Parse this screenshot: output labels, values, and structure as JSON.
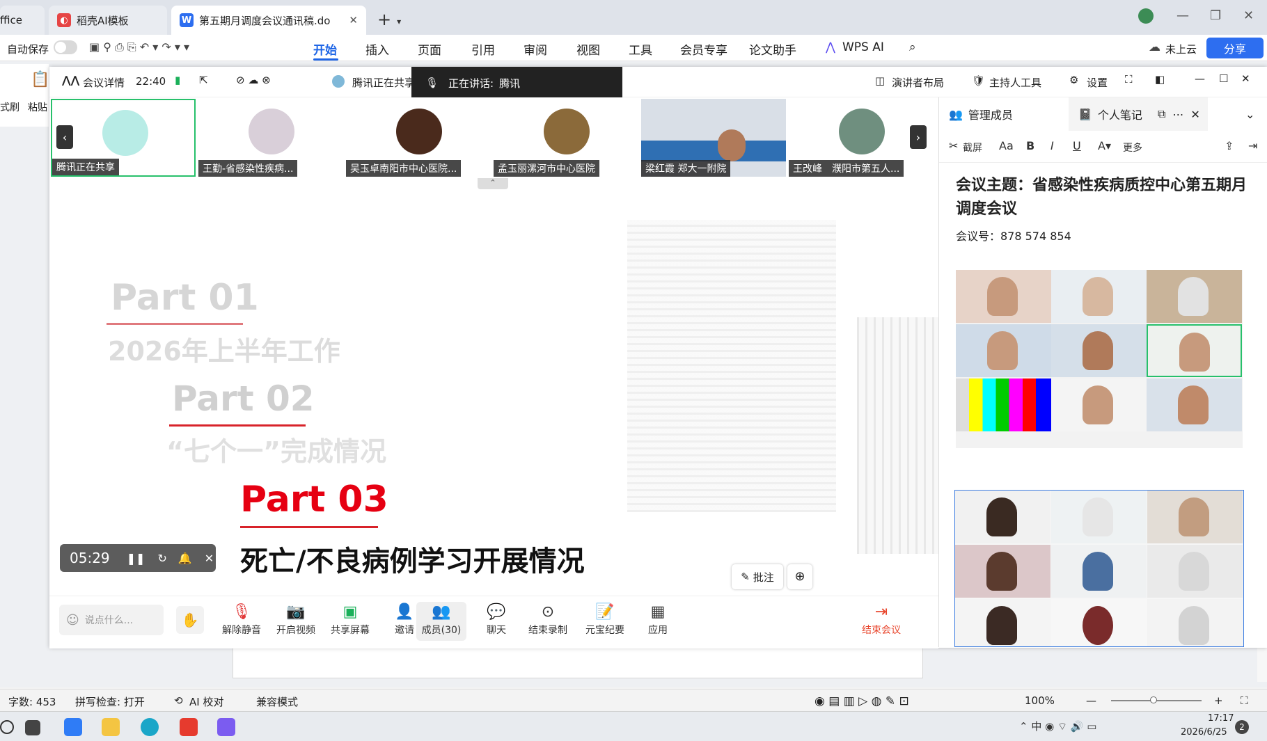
{
  "wps": {
    "tabs": [
      {
        "label": "ffice"
      },
      {
        "label": "稻壳AI模板"
      },
      {
        "label": "第五期月调度会议通讯稿.do"
      }
    ],
    "autosave_label": "自动保存",
    "menu": [
      "开始",
      "插入",
      "页面",
      "引用",
      "审阅",
      "视图",
      "工具",
      "会员专享",
      "论文助手",
      "WPS AI"
    ],
    "cloud_label": "未上云",
    "share_label": "分享",
    "left_labels": [
      "式刷",
      "粘贴"
    ]
  },
  "meeting": {
    "details_label": "会议详情",
    "time": "22:40",
    "sharing_label": "腾讯正在共享",
    "speaking_label": "正在讲话:",
    "speaking_name": "腾讯",
    "layout_label": "演讲者布局",
    "host_tools_label": "主持人工具",
    "settings_label": "设置",
    "participants": [
      {
        "name": "腾讯正在共享"
      },
      {
        "name": "王勤-省感染性疾病..."
      },
      {
        "name": "吴玉卓南阳市中心医院..."
      },
      {
        "name": "孟玉丽漯河市中心医院"
      },
      {
        "name": "梁红霞 郑大一附院"
      },
      {
        "name": "王改峰　濮阳市第五人..."
      }
    ],
    "slide": {
      "part1": "Part 01",
      "part1_sub": "2026年上半年工作",
      "part2": "Part 02",
      "part2_sub": "“七个一”完成情况",
      "part3": "Part 03",
      "part3_sub": "死亡/不良病例学习开展情况",
      "annotate_label": "批注"
    },
    "timer": "05:29",
    "chat_placeholder": "说点什么...",
    "toolbar": [
      {
        "label": "解除静音"
      },
      {
        "label": "开启视频"
      },
      {
        "label": "共享屏幕"
      },
      {
        "label": "邀请"
      },
      {
        "label": "成员(30)"
      },
      {
        "label": "聊天"
      },
      {
        "label": "结束录制"
      },
      {
        "label": "元宝纪要"
      },
      {
        "label": "应用"
      }
    ],
    "end_label": "结束会议"
  },
  "notes": {
    "tab_members": "管理成员",
    "tab_notes": "个人笔记",
    "tools": {
      "screenshot": "截屏",
      "more": "更多"
    },
    "title": "会议主题：省感染性疾病质控中心第五期月调度会议",
    "meeting_id": "会议号：878 574 854"
  },
  "status": {
    "word_count": "字数: 453",
    "spell_check": "拼写检查: 打开",
    "ai_check": "AI 校对",
    "compat_mode": "兼容模式",
    "zoom": "100%"
  },
  "taskbar": {
    "time": "17:17",
    "date": "2026/6/25",
    "notifications": "2"
  },
  "colors": {
    "accent": "#1c64e6",
    "slide_red": "#d8232a",
    "end_meeting": "#e8462d",
    "speaking_bg": "#222222"
  }
}
